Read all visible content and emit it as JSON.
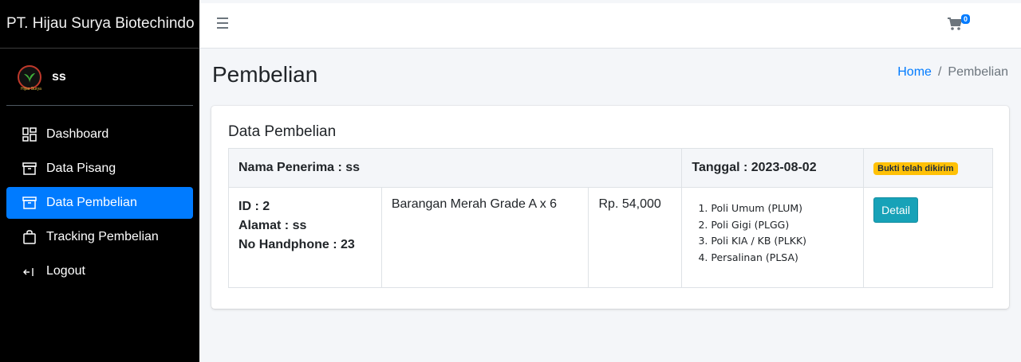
{
  "brand": {
    "name": "PT. Hijau Surya Biotechindo"
  },
  "user": {
    "name": "ss",
    "logo_text": "Hijau Surya"
  },
  "sidebar": {
    "items": [
      {
        "label": "Dashboard",
        "icon": "dashboard-icon"
      },
      {
        "label": "Data Pisang",
        "icon": "archive-icon"
      },
      {
        "label": "Data Pembelian",
        "icon": "archive-icon",
        "active": true
      },
      {
        "label": "Tracking Pembelian",
        "icon": "shopping-bag-icon"
      },
      {
        "label": "Logout",
        "icon": "logout-icon"
      }
    ]
  },
  "topbar": {
    "cart_count": "0"
  },
  "page": {
    "title": "Pembelian"
  },
  "breadcrumb": {
    "home": "Home",
    "separator": "/",
    "current": "Pembelian"
  },
  "card": {
    "title": "Data Pembelian",
    "header": {
      "recipient": "Nama Penerima : ss",
      "date": "Tanggal : 2023-08-02",
      "status_badge": "Bukti telah dikirim"
    },
    "row": {
      "id": "ID : 2",
      "address": "Alamat : ss",
      "phone": "No Handphone : 23",
      "item": "Barangan Merah Grade A x 6",
      "price": "Rp. 54,000",
      "poli": [
        "Poli Umum (PLUM)",
        "Poli Gigi (PLGG)",
        "Poli KIA / KB (PLKK)",
        "Persalinan (PLSA)"
      ],
      "detail_label": "Detail"
    }
  },
  "colors": {
    "sidebar_bg": "#000000",
    "active": "#007bff",
    "badge": "#ffc107",
    "detail_button": "#17a2b8"
  }
}
